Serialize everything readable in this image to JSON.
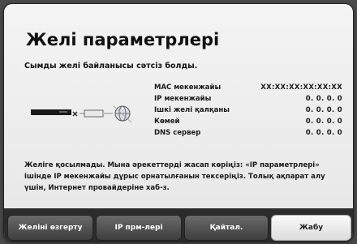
{
  "dialog": {
    "title": "Желі параметрлері",
    "subtitle": "Сымды желі байланысы сәтсіз болды.",
    "info": [
      {
        "label": "MAC мекенжайы",
        "value": "XX:XX:XX:XX:XX:XX"
      },
      {
        "label": "IP мекенжайы",
        "value": "0.  0.  0.  0"
      },
      {
        "label": "Ішкі желі қалқаны",
        "value": "0.  0.  0.  0"
      },
      {
        "label": "Көмей",
        "value": "0.  0.  0.  0"
      },
      {
        "label": "DNS сервер",
        "value": "0.  0.  0.  0"
      }
    ],
    "message": "Желіге қосылмады. Мына әрекеттерді жасап көріңіз: «IP параметрлері» ішінде IP мекенжайы дұрыс орнатылғанын тексеріңіз. Толық ақпарат алу үшін, Интернет провайдеріне хаб-з.",
    "buttons": {
      "change_network": "Желіні өзгерту",
      "ip_settings": "IP прм-лері",
      "retry": "Қайтал.",
      "close": "Жабу"
    }
  },
  "colors": {
    "background": "#4a4a4a",
    "panel": "#eeeeee",
    "button_bar": "#2c2c2c",
    "button_active": "#f2f2f2"
  },
  "icons": [
    "tv-device-icon",
    "disconnected-x-icon",
    "router-icon",
    "globe-icon"
  ]
}
